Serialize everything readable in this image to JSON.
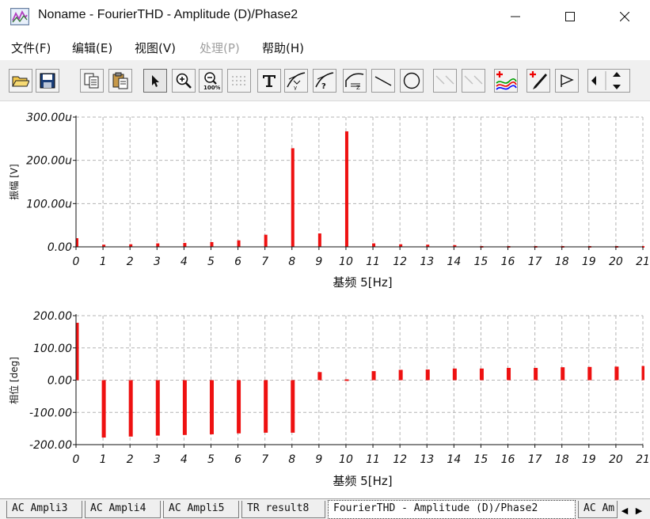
{
  "window": {
    "title": "Noname - FourierTHD - Amplitude (D)/Phase2",
    "controls": [
      "minimize",
      "maximize",
      "close"
    ]
  },
  "menu": [
    {
      "label": "文件(F)",
      "enabled": true
    },
    {
      "label": "编辑(E)",
      "enabled": true
    },
    {
      "label": "视图(V)",
      "enabled": true
    },
    {
      "label": "处理(P)",
      "enabled": false
    },
    {
      "label": "帮助(H)",
      "enabled": true
    }
  ],
  "toolbar": [
    {
      "icon": "open-folder-icon"
    },
    {
      "icon": "save-icon"
    },
    {
      "icon": "copy-icon"
    },
    {
      "icon": "paste-icon"
    },
    {
      "icon": "pointer-icon",
      "active": true
    },
    {
      "icon": "zoom-in-icon"
    },
    {
      "icon": "zoom-100-icon"
    },
    {
      "icon": "grid-icon",
      "disabled": true
    },
    {
      "icon": "text-icon"
    },
    {
      "icon": "tangent-y-icon"
    },
    {
      "icon": "tangent-query-icon"
    },
    {
      "icon": "curve-z-icon"
    },
    {
      "icon": "line-icon"
    },
    {
      "icon": "ellipse-icon"
    },
    {
      "icon": "cursor-line-1-icon",
      "disabled": true
    },
    {
      "icon": "cursor-line-2-icon",
      "disabled": true
    },
    {
      "icon": "add-curve-icon"
    },
    {
      "icon": "add-marker-icon"
    },
    {
      "icon": "step-icon"
    },
    {
      "icon": "cursor-arrows-icon"
    }
  ],
  "chart_data": [
    {
      "type": "bar",
      "title": "",
      "ylabel": "振幅 [V]",
      "xlabel": "基频 5[Hz]",
      "ylim": [
        0,
        300
      ],
      "xlim": [
        0,
        21
      ],
      "grid": true,
      "y_ticks": [
        "0.00",
        "100.00u",
        "200.00u",
        "300.00u"
      ],
      "x_ticks": [
        "0",
        "1",
        "2",
        "3",
        "4",
        "5",
        "6",
        "7",
        "8",
        "9",
        "10",
        "11",
        "12",
        "13",
        "14",
        "15",
        "16",
        "17",
        "18",
        "19",
        "20",
        "21"
      ],
      "unit": "u",
      "color": "#ee1111",
      "x": [
        0,
        1,
        2,
        3,
        4,
        5,
        6,
        7,
        8,
        9,
        10,
        11,
        12,
        13,
        14,
        15,
        16,
        17,
        18,
        19,
        20,
        21
      ],
      "values": [
        20,
        5,
        6,
        8,
        9,
        11,
        15,
        28,
        228,
        31,
        267,
        8,
        6,
        5,
        4,
        3,
        3,
        3,
        2,
        2,
        2,
        2
      ]
    },
    {
      "type": "bar",
      "title": "",
      "ylabel": "相位 [deg]",
      "xlabel": "基频 5[Hz]",
      "ylim": [
        -200,
        200
      ],
      "xlim": [
        0,
        21
      ],
      "grid": true,
      "y_ticks": [
        "-200.00",
        "-100.00",
        "0.00",
        "100.00",
        "200.00"
      ],
      "x_ticks": [
        "0",
        "1",
        "2",
        "3",
        "4",
        "5",
        "6",
        "7",
        "8",
        "9",
        "10",
        "11",
        "12",
        "13",
        "14",
        "15",
        "16",
        "17",
        "18",
        "19",
        "20",
        "21"
      ],
      "color": "#ee1111",
      "x": [
        0,
        1,
        2,
        3,
        4,
        5,
        6,
        7,
        8,
        9,
        10,
        11,
        12,
        13,
        14,
        15,
        16,
        17,
        18,
        19,
        20,
        21
      ],
      "values": [
        178,
        -178,
        -175,
        -172,
        -170,
        -168,
        -165,
        -163,
        -163,
        25,
        1,
        28,
        32,
        33,
        36,
        36,
        38,
        38,
        40,
        41,
        42,
        44
      ]
    }
  ],
  "tabs": [
    {
      "label": "AC Ampli3",
      "active": false
    },
    {
      "label": "AC Ampli4",
      "active": false
    },
    {
      "label": "AC Ampli5",
      "active": false
    },
    {
      "label": "TR result8",
      "active": false
    },
    {
      "label": "FourierTHD - Amplitude (D)/Phase2",
      "active": true
    },
    {
      "label": "AC Am",
      "active": false
    }
  ]
}
